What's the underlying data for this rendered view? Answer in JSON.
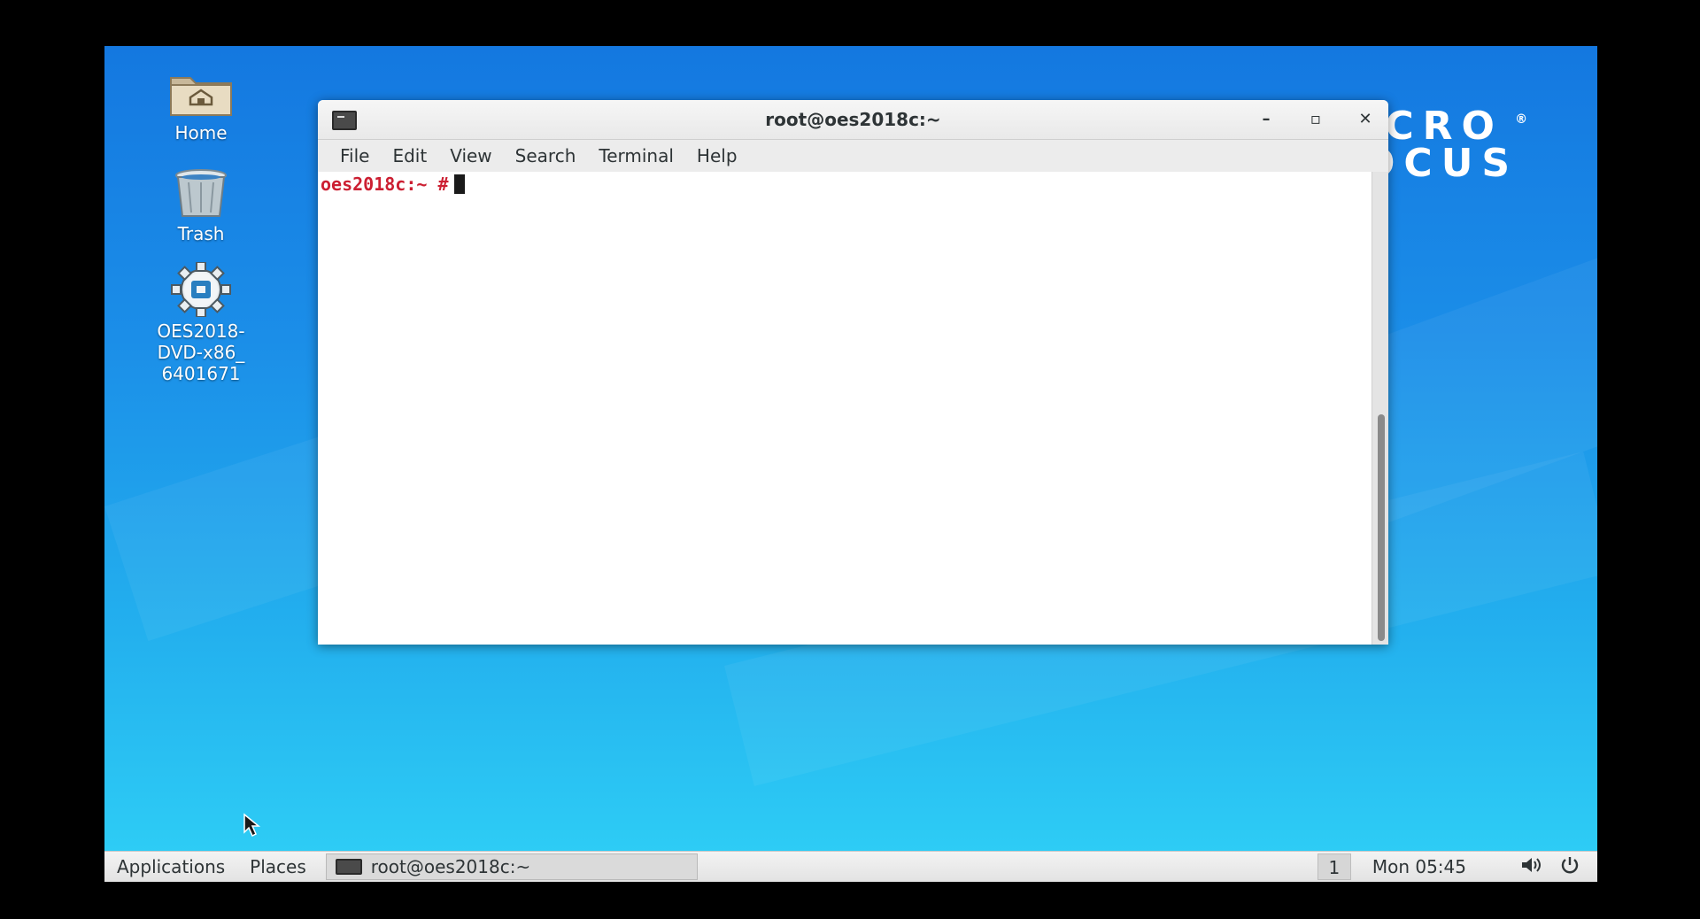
{
  "desktop": {
    "icons": [
      {
        "label": "Home"
      },
      {
        "label": "Trash"
      },
      {
        "label": "OES2018-DVD-x86_ 6401671"
      }
    ],
    "brand_text_line1": "ICRO",
    "brand_text_line2": "OCUS",
    "brand_reg": "®"
  },
  "window": {
    "title": "root@oes2018c:~",
    "minimize_label": "–",
    "maximize_label": "▫",
    "close_label": "✕",
    "menu": [
      "File",
      "Edit",
      "View",
      "Search",
      "Terminal",
      "Help"
    ],
    "terminal": {
      "prompt": "oes2018c:~ #",
      "scroll_thumb_fraction": 0.48
    }
  },
  "taskbar": {
    "applications_label": "Applications",
    "places_label": "Places",
    "task_label": "root@oes2018c:~",
    "workspace": "1",
    "clock": "Mon 05:45",
    "volume_icon": "volume-icon",
    "power_icon": "power-icon"
  },
  "colors": {
    "prompt": "#cc1f32",
    "desktop_top": "#1478e0",
    "desktop_bottom": "#2fd0f6"
  }
}
